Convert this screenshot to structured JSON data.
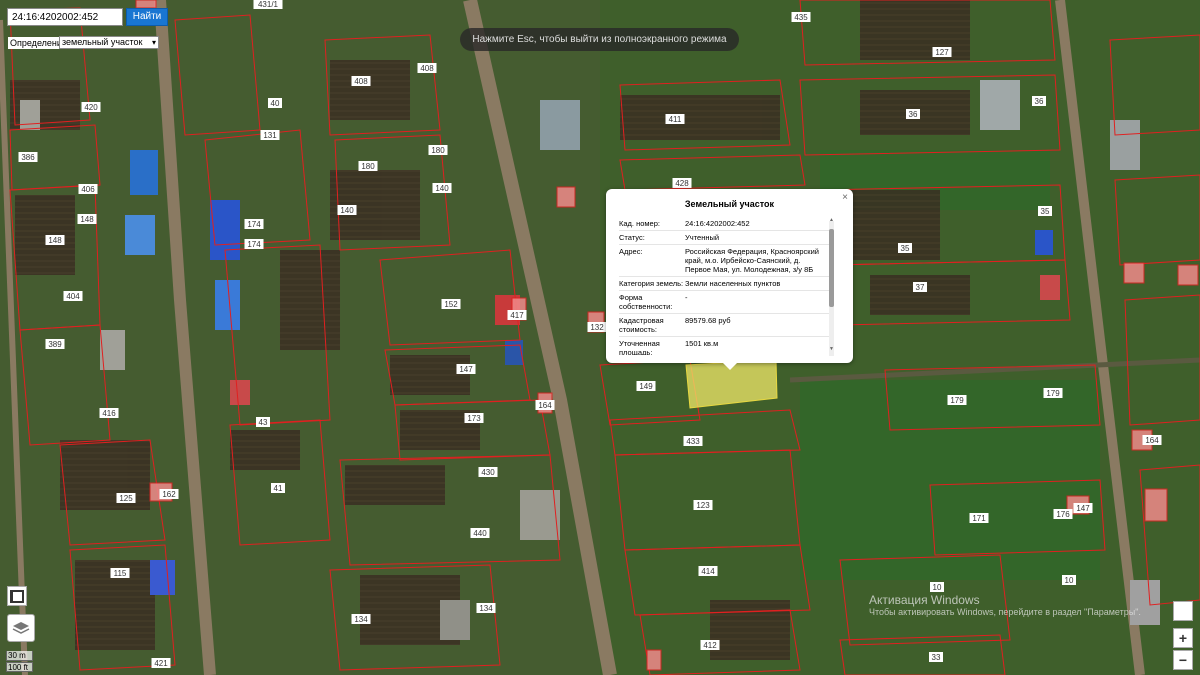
{
  "search": {
    "value": "24:16:4202002:452",
    "button_label": "Найти"
  },
  "definition": {
    "label": "Определение",
    "selected": "земельный участок"
  },
  "fullscreen_hint": "Нажмите Esc, чтобы выйти из полноэкранного режима",
  "popup": {
    "title": "Земельный участок",
    "close": "×",
    "rows": [
      {
        "key": "Кад. номер:",
        "value": "24:16:4202002:452"
      },
      {
        "key": "Статус:",
        "value": "Учтенный"
      },
      {
        "key": "Адрес:",
        "value": "Российская Федерация, Красноярский край, м.о. Ирбейско-Саянский, д. Первое Мая, ул. Молодежная, з/у 8Б"
      },
      {
        "key": "Категория земель:",
        "value": "Земли населенных пунктов"
      },
      {
        "key": "Форма собственности:",
        "value": "-"
      },
      {
        "key": "Кадастровая стоимость:",
        "value": "89579.68 руб"
      },
      {
        "key": "Уточненная площадь:",
        "value": "1501 кв.м"
      }
    ]
  },
  "scale": {
    "metric": "30 m",
    "imperial": "100 ft"
  },
  "zoom": {
    "in": "+",
    "out": "−"
  },
  "watermark": {
    "title": "Активация Windows",
    "subtitle": "Чтобы активировать Windows, перейдите в раздел \"Параметры\"."
  },
  "plot_labels": [
    "431/1",
    "435",
    "420",
    "408",
    "408",
    "40",
    "127",
    "36",
    "386",
    "131",
    "180",
    "180",
    "411",
    "36",
    "406",
    "148",
    "140",
    "140",
    "428",
    "35",
    "148",
    "174",
    "35",
    "174",
    "404",
    "152",
    "37",
    "389",
    "132",
    "417",
    "147",
    "149",
    "179",
    "179",
    "416",
    "43",
    "173",
    "164",
    "433",
    "164",
    "430",
    "123",
    "41",
    "125",
    "162",
    "171",
    "176",
    "147",
    "440",
    "134",
    "134",
    "115",
    "414",
    "10",
    "412",
    "421",
    "33",
    "10"
  ],
  "colors": {
    "parcel_border": "#e02020",
    "selected_fill": "#f2e86a",
    "search_button": "#1976d2"
  }
}
